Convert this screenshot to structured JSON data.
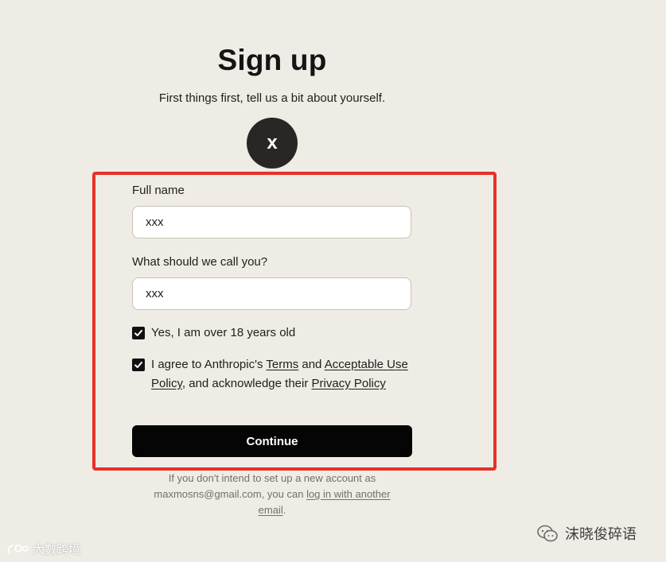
{
  "header": {
    "title": "Sign up",
    "subtitle": "First things first, tell us a bit about yourself."
  },
  "avatar": {
    "initial": "x"
  },
  "form": {
    "full_name": {
      "label": "Full name",
      "value": "xxx"
    },
    "nickname": {
      "label": "What should we call you?",
      "value": "xxx"
    },
    "age_check": {
      "label": "Yes, I am over 18 years old",
      "checked": true
    },
    "agreement": {
      "checked": true,
      "prefix": "I agree to Anthropic's ",
      "terms_link": "Terms",
      "and_text": " and ",
      "aup_link": "Acceptable Use Policy",
      "middle_text": ", and acknowledge their ",
      "privacy_link": "Privacy Policy"
    },
    "continue_label": "Continue"
  },
  "footer": {
    "line1": "If you don't intend to set up a new account as",
    "email": "maxmosns@gmail.com",
    "line2_suffix": ", you can ",
    "login_link": "log in with another email",
    "period": "."
  },
  "watermarks": {
    "right_text": "沫晓俊碎语",
    "left_text": "大數跨境",
    "right_icon": "wechat-icon",
    "left_icon": "logo-icon"
  },
  "colors": {
    "background": "#efece6",
    "highlight": "#e8302a",
    "button": "#050505"
  }
}
